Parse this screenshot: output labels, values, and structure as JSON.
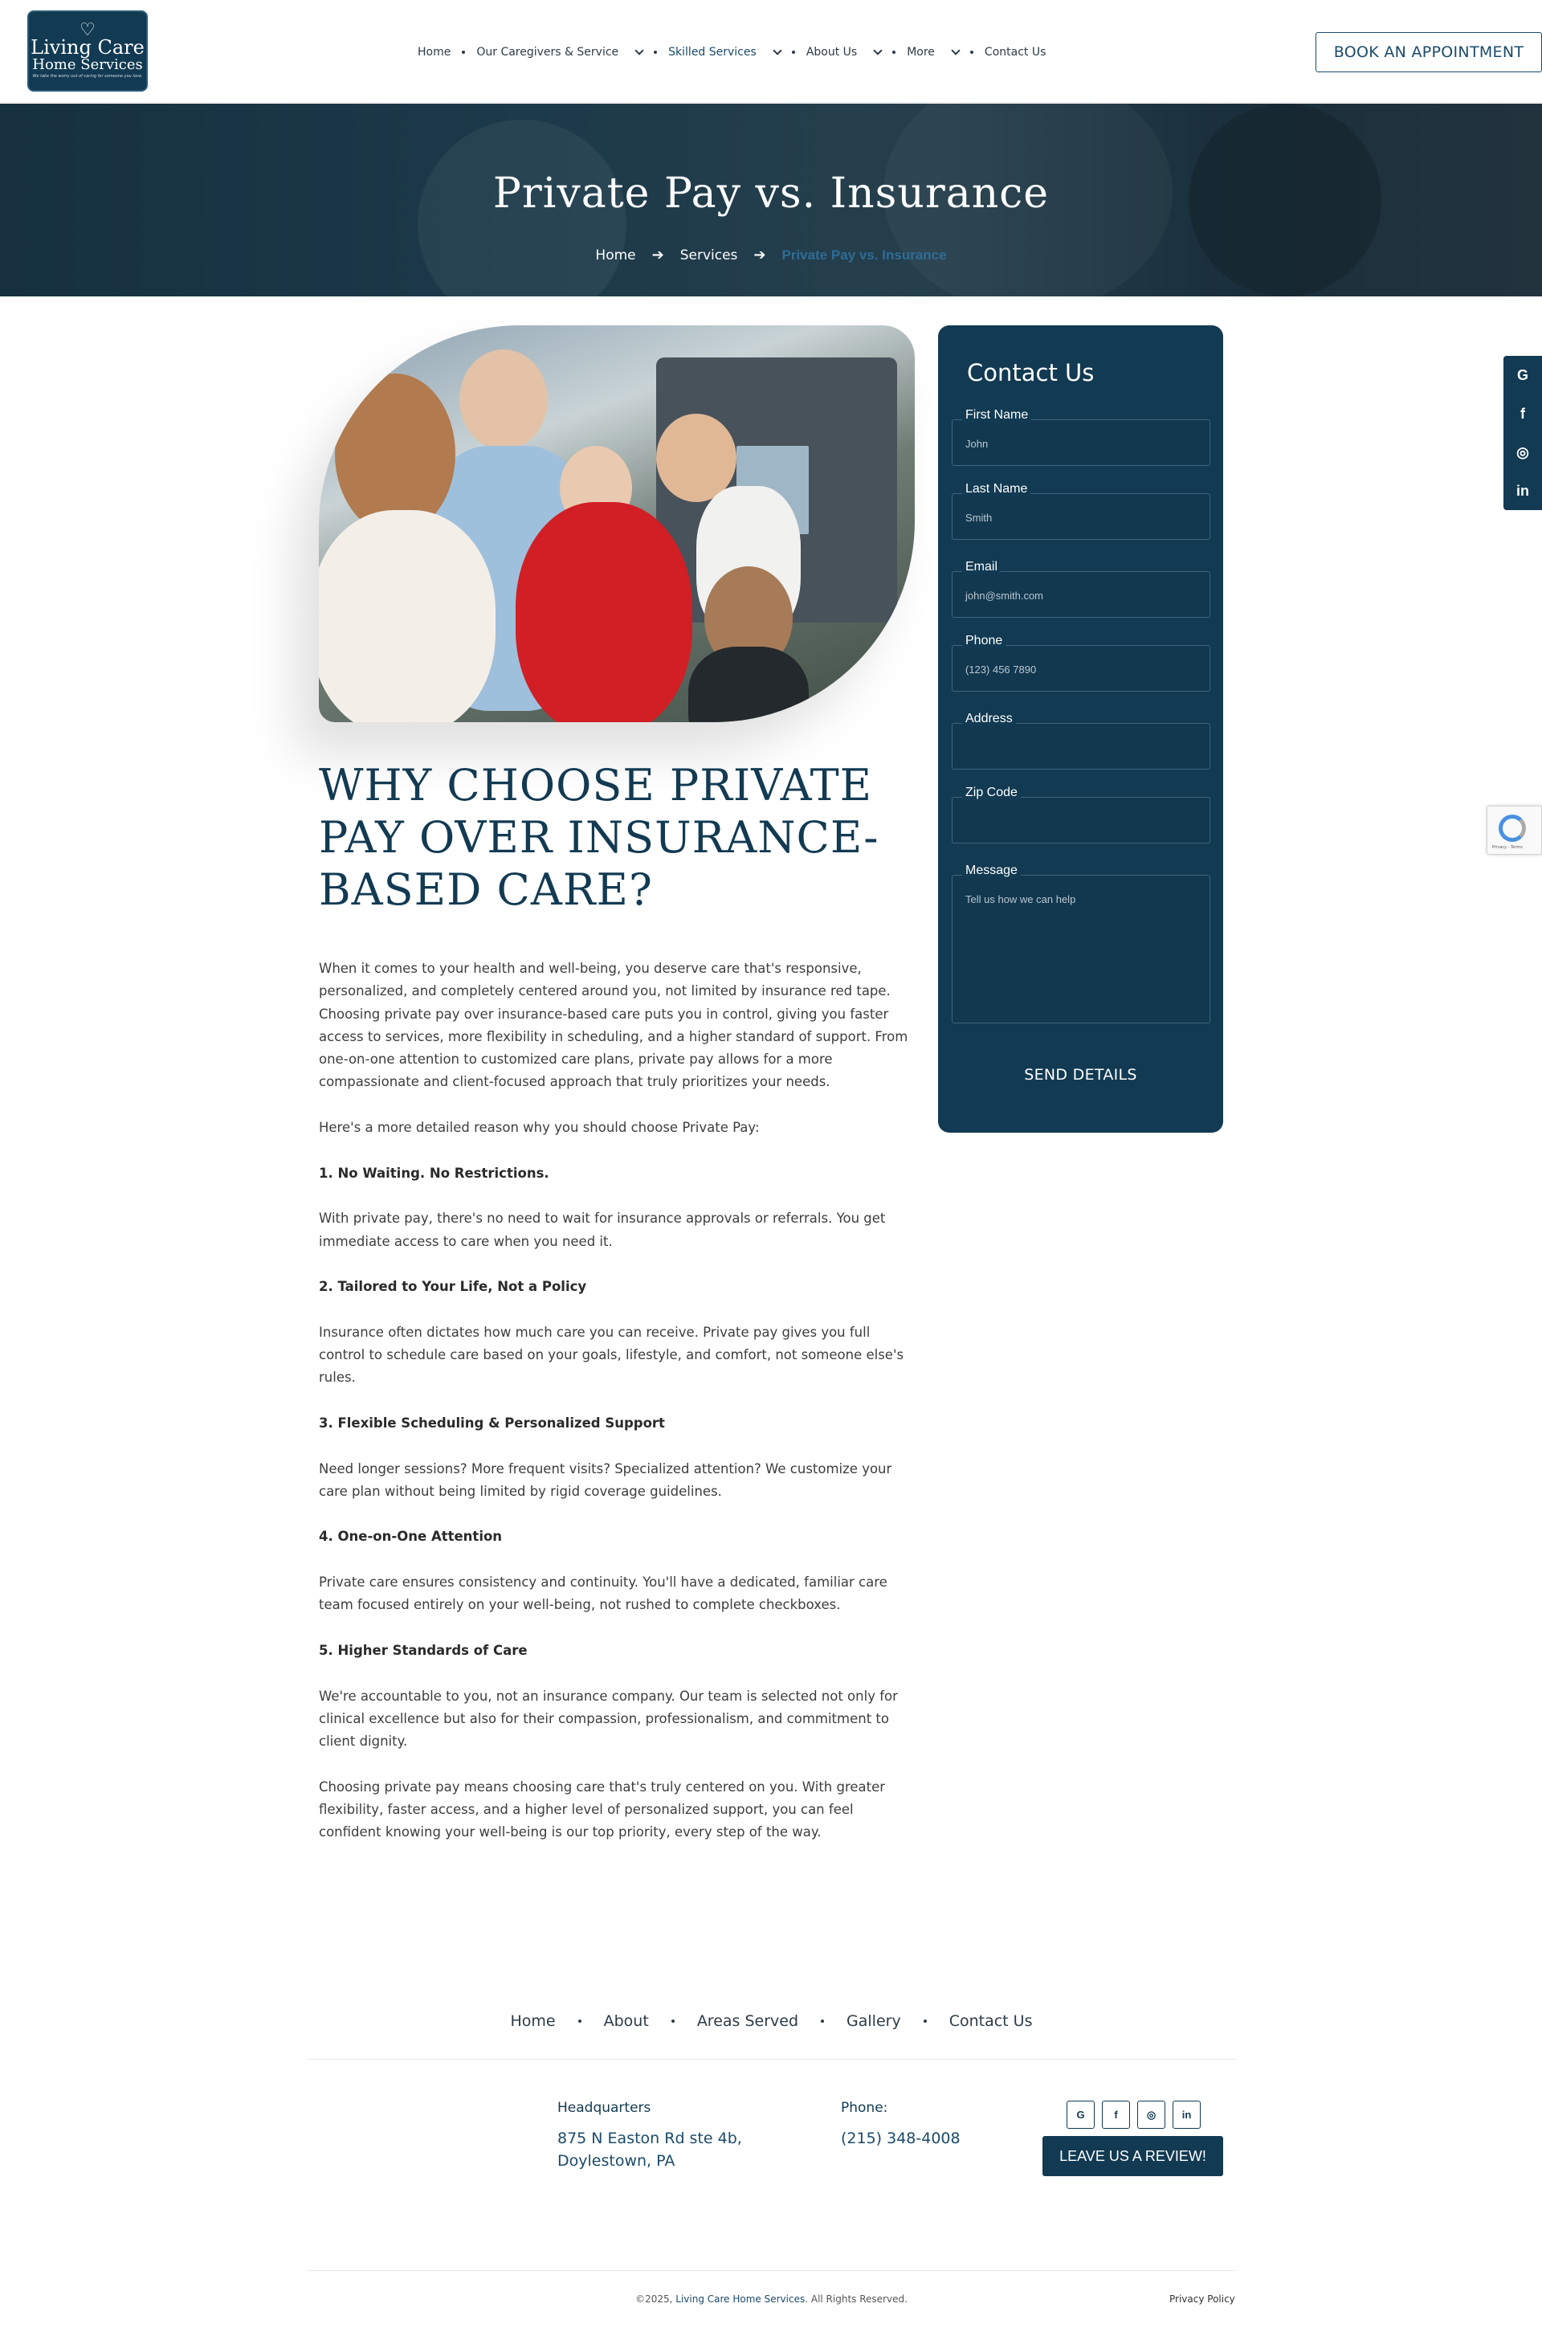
{
  "header": {
    "logo": {
      "line1": "Living Care",
      "line2": "Home Services",
      "tagline": "We take the worry out of caring for someone you love."
    },
    "nav": [
      {
        "label": "Home"
      },
      {
        "label": "Our Caregivers & Service"
      },
      {
        "label": "Skilled Services"
      },
      {
        "label": "About Us"
      },
      {
        "label": "More"
      },
      {
        "label": "Contact Us"
      }
    ],
    "book_label": "BOOK AN APPOINTMENT"
  },
  "hero": {
    "title": "Private Pay vs. Insurance",
    "breadcrumb": [
      "Home",
      "Services",
      "Private Pay vs. Insurance"
    ]
  },
  "article": {
    "heading": "WHY CHOOSE PRIVATE PAY OVER INSURANCE-BASED CARE?",
    "intro": "When it comes to your health and well-being, you deserve care that's responsive, personalized, and completely centered around you, not limited by insurance red tape. Choosing private pay over insurance-based care puts you in control, giving you faster access to services, more flexibility in scheduling, and a higher standard of support. From one-on-one attention to customized care plans, private pay allows for a more compassionate and client-focused approach that truly prioritizes your needs.",
    "lead": "Here's a more detailed reason why you should choose Private Pay:",
    "points": [
      {
        "title": "1. No Waiting. No Restrictions.",
        "text": "With private pay, there's no need to wait for insurance approvals or referrals. You get immediate access to care when you need it."
      },
      {
        "title": "2. Tailored to Your Life, Not a Policy",
        "text": "Insurance often dictates how much care you can receive. Private pay gives you full control to schedule care based on your goals, lifestyle, and comfort, not someone else's rules."
      },
      {
        "title": "3. Flexible Scheduling & Personalized Support",
        "text": "Need longer sessions? More frequent visits? Specialized attention? We customize your care plan without being limited by rigid coverage guidelines."
      },
      {
        "title": "4. One-on-One Attention",
        "text": "Private care ensures consistency and continuity. You'll have a dedicated, familiar care team focused entirely on your well-being, not rushed to complete checkboxes."
      },
      {
        "title": "5. Higher Standards of Care",
        "text": "We're accountable to you, not an insurance company. Our team is selected not only for clinical excellence but also for their compassion, professionalism, and commitment to client dignity."
      }
    ],
    "closing": "Choosing private pay means choosing care that's truly centered on you. With greater flexibility, faster access, and a higher level of personalized support, you can feel confident knowing your well-being is our top priority, every step of the way."
  },
  "form": {
    "title": "Contact Us",
    "fields": [
      {
        "label": "First Name",
        "placeholder": "John"
      },
      {
        "label": "Last Name",
        "placeholder": "Smith"
      },
      {
        "label": "Email",
        "placeholder": "john@smith.com"
      },
      {
        "label": "Phone",
        "placeholder": "(123) 456 7890"
      },
      {
        "label": "Address",
        "placeholder": ""
      },
      {
        "label": "Zip Code",
        "placeholder": ""
      },
      {
        "label": "Message",
        "placeholder": "Tell us how we can help"
      }
    ],
    "submit_label": "SEND DETAILS"
  },
  "social_tab": [
    {
      "icon": "google-icon",
      "glyph": "G"
    },
    {
      "icon": "facebook-icon",
      "glyph": "f"
    },
    {
      "icon": "instagram-icon",
      "glyph": "◎"
    },
    {
      "icon": "linkedin-icon",
      "glyph": "in"
    }
  ],
  "recaptcha": {
    "text": "Privacy - Terms"
  },
  "footer": {
    "nav": [
      "Home",
      "About",
      "Areas Served",
      "Gallery",
      "Contact Us"
    ],
    "hq_title": "Headquarters",
    "hq_line1": "875 N Easton Rd ste 4b,",
    "hq_line2": "Doylestown, PA",
    "phone_title": "Phone:",
    "phone": "(215) 348-4008",
    "icons": [
      {
        "icon": "google-icon",
        "glyph": "G"
      },
      {
        "icon": "facebook-icon",
        "glyph": "f"
      },
      {
        "icon": "instagram-icon",
        "glyph": "◎"
      },
      {
        "icon": "linkedin-icon",
        "glyph": "in"
      }
    ],
    "review_label": "LEAVE US A REVIEW!",
    "copyright_prefix": "©2025, ",
    "copyright_brand": "Living Care Home Services",
    "copyright_suffix": ". All Rights Reserved.",
    "privacy": "Privacy Policy"
  },
  "colors": {
    "brand": "#123a52",
    "accent": "#2e6c95"
  }
}
